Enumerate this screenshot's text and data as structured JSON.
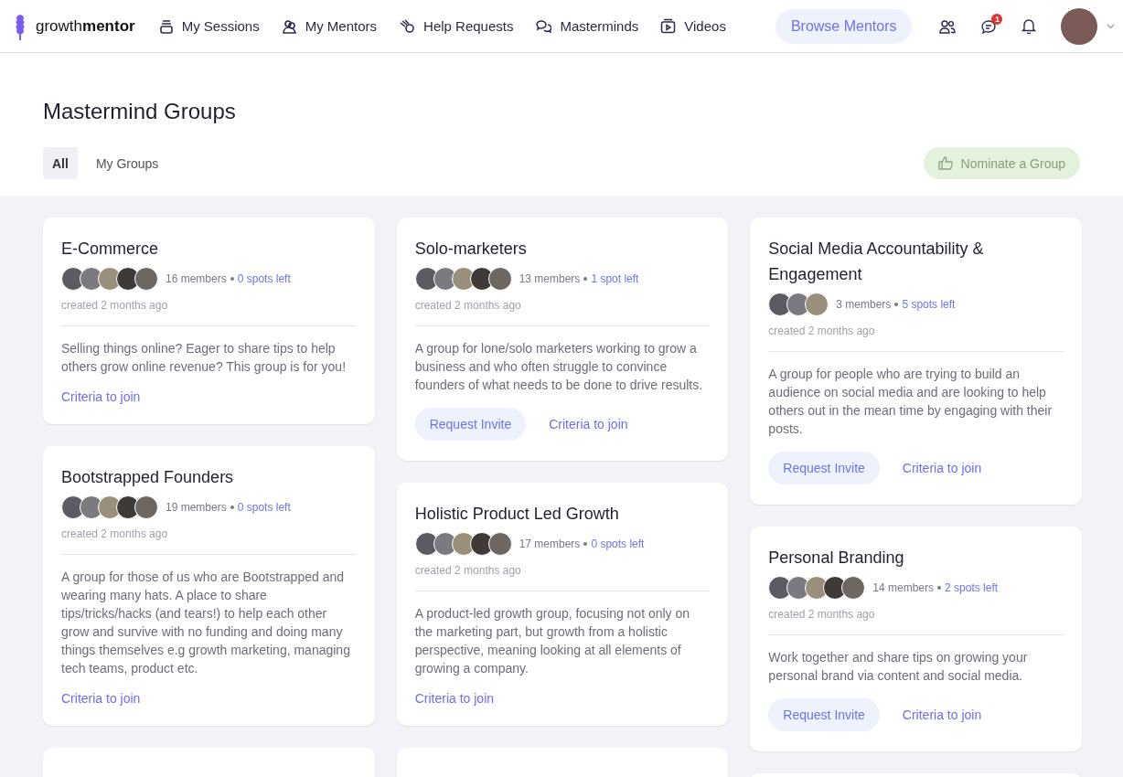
{
  "brand": {
    "light": "growth",
    "bold": "mentor"
  },
  "nav": [
    {
      "label": "My Sessions"
    },
    {
      "label": "My Mentors"
    },
    {
      "label": "Help Requests"
    },
    {
      "label": "Masterminds"
    },
    {
      "label": "Videos"
    }
  ],
  "browse_button": "Browse Mentors",
  "notification_badge": "1",
  "page_title": "Mastermind Groups",
  "tabs": [
    {
      "label": "All",
      "selected": true
    },
    {
      "label": "My Groups",
      "selected": false
    }
  ],
  "nominate_button": "Nominate a Group",
  "columns": [
    [
      {
        "title": "E-Commerce",
        "avatars": [
          {
            "kind": "photo"
          },
          {
            "kind": "photo"
          },
          {
            "kind": "photo"
          },
          {
            "kind": "photo"
          },
          {
            "kind": "photo"
          }
        ],
        "members": "16 members",
        "spots": "0 spots left",
        "created": "created 2 months ago",
        "description": "Selling things online? Eager to share tips to help others grow online revenue? This group is for you!",
        "criteria": "Criteria to join"
      },
      {
        "title": "Bootstrapped Founders",
        "avatars": [
          {
            "kind": "photo"
          },
          {
            "kind": "photo"
          },
          {
            "kind": "photo"
          },
          {
            "kind": "photo"
          },
          {
            "kind": "photo"
          }
        ],
        "members": "19 members",
        "spots": "0 spots left",
        "created": "created 2 months ago",
        "description": "A group for those of us who are Bootstrapped and wearing many hats. A place to share tips/tricks/hacks (and tears!) to help each other grow and survive with no funding and doing many things themselves e.g growth marketing, managing tech teams, product etc.",
        "criteria": "Criteria to join"
      }
    ],
    [
      {
        "title": "Solo-marketers",
        "avatars": [
          {
            "kind": "photo"
          },
          {
            "kind": "photo"
          },
          {
            "kind": "photo"
          },
          {
            "kind": "photo"
          },
          {
            "kind": "photo"
          }
        ],
        "members": "13 members",
        "spots": "1 spot left",
        "created": "created 2 months ago",
        "description": "A group for lone/solo marketers working to grow a business and who often struggle to convince founders of what needs to be done to drive results.",
        "invite": "Request Invite",
        "criteria": "Criteria to join"
      },
      {
        "title": "Holistic Product Led Growth",
        "avatars": [
          {
            "kind": "photo"
          },
          {
            "kind": "photo"
          },
          {
            "kind": "photo"
          },
          {
            "kind": "photo"
          },
          {
            "kind": "photo"
          }
        ],
        "members": "17 members",
        "spots": "0 spots left",
        "created": "created 2 months ago",
        "description": "A product-led growth group, focusing not only on the marketing part, but growth from a holistic perspective, meaning looking at all elements of growing a company.",
        "criteria": "Criteria to join"
      }
    ],
    [
      {
        "title": "Social Media Accountability & Engagement",
        "avatars": [
          {
            "kind": "photo"
          },
          {
            "kind": "photo"
          },
          {
            "kind": "photo"
          }
        ],
        "members": "3 members",
        "spots": "5 spots left",
        "created": "created 2 months ago",
        "description": "A group for people who are trying to build an audience on social media and are looking to help others out in the mean time by engaging with their posts.",
        "invite": "Request Invite",
        "criteria": "Criteria to join"
      },
      {
        "title": "Personal Branding",
        "avatars": [
          {
            "kind": "photo"
          },
          {
            "kind": "photo"
          },
          {
            "kind": "photo"
          },
          {
            "kind": "photo"
          },
          {
            "kind": "photo"
          }
        ],
        "members": "14 members",
        "spots": "2 spots left",
        "created": "created 2 months ago",
        "description": "Work together and share tips on growing your personal brand via content and social media.",
        "invite": "Request Invite",
        "criteria": "Criteria to join"
      }
    ]
  ]
}
